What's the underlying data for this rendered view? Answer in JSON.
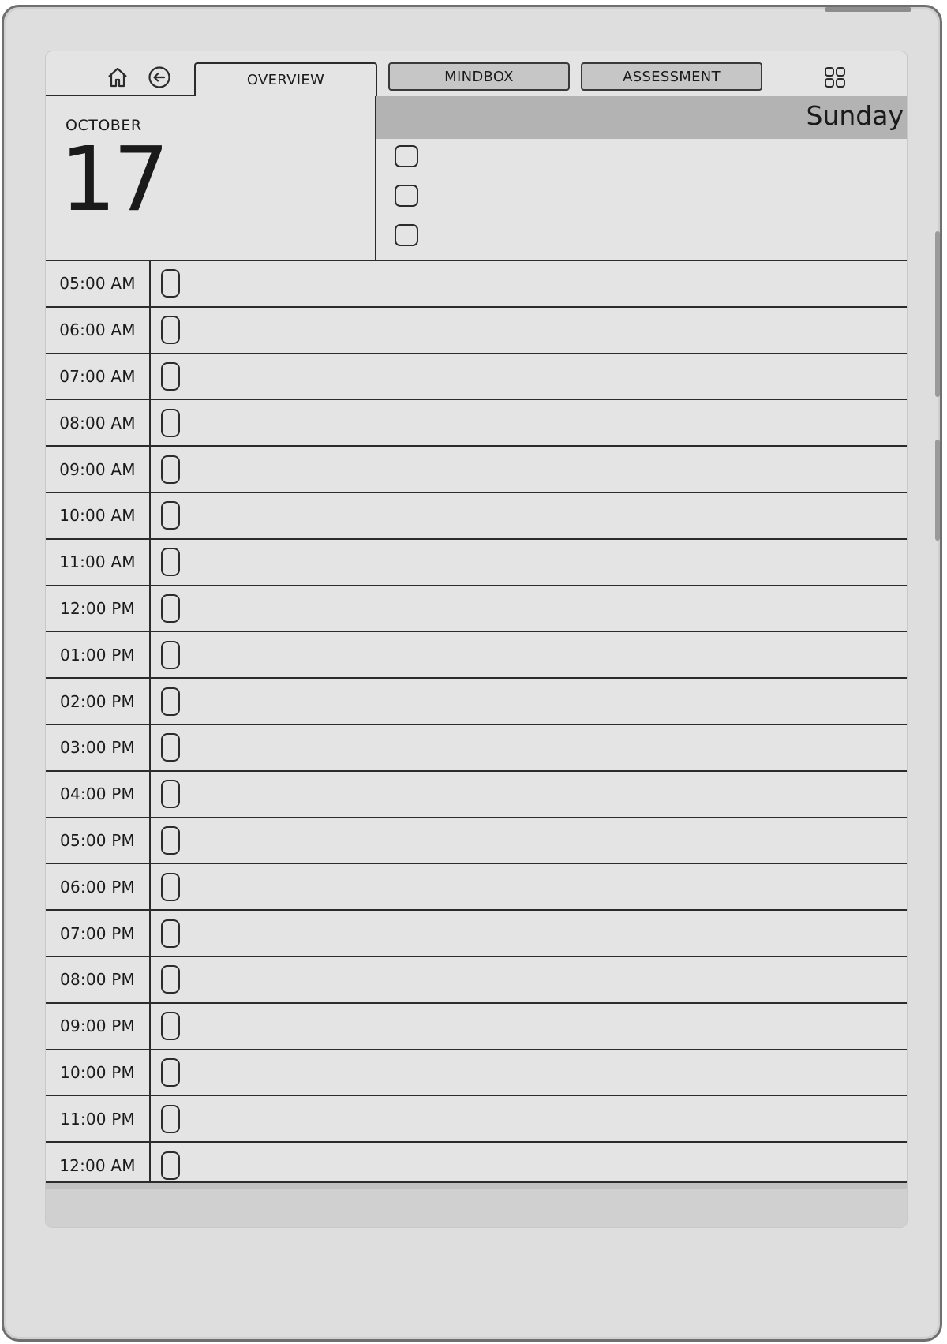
{
  "nav": {
    "home_icon": "home-icon",
    "back_icon": "back-arrow-icon",
    "grid_icon": "grid-icon"
  },
  "tabs": [
    {
      "label": "OVERVIEW",
      "active": true
    },
    {
      "label": "MINDBOX",
      "active": false
    },
    {
      "label": "ASSESSMENT",
      "active": false
    }
  ],
  "date": {
    "month": "OCTOBER",
    "day": "17",
    "weekday": "Sunday"
  },
  "todos": [
    {
      "checked": false
    },
    {
      "checked": false
    },
    {
      "checked": false
    }
  ],
  "schedule": [
    {
      "time": "05:00 AM",
      "checked": false,
      "entry": ""
    },
    {
      "time": "06:00 AM",
      "checked": false,
      "entry": ""
    },
    {
      "time": "07:00 AM",
      "checked": false,
      "entry": ""
    },
    {
      "time": "08:00 AM",
      "checked": false,
      "entry": ""
    },
    {
      "time": "09:00 AM",
      "checked": false,
      "entry": ""
    },
    {
      "time": "10:00 AM",
      "checked": false,
      "entry": ""
    },
    {
      "time": "11:00 AM",
      "checked": false,
      "entry": ""
    },
    {
      "time": "12:00 PM",
      "checked": false,
      "entry": ""
    },
    {
      "time": "01:00 PM",
      "checked": false,
      "entry": ""
    },
    {
      "time": "02:00 PM",
      "checked": false,
      "entry": ""
    },
    {
      "time": "03:00 PM",
      "checked": false,
      "entry": ""
    },
    {
      "time": "04:00 PM",
      "checked": false,
      "entry": ""
    },
    {
      "time": "05:00 PM",
      "checked": false,
      "entry": ""
    },
    {
      "time": "06:00 PM",
      "checked": false,
      "entry": ""
    },
    {
      "time": "07:00 PM",
      "checked": false,
      "entry": ""
    },
    {
      "time": "08:00 PM",
      "checked": false,
      "entry": ""
    },
    {
      "time": "09:00 PM",
      "checked": false,
      "entry": ""
    },
    {
      "time": "10:00 PM",
      "checked": false,
      "entry": ""
    },
    {
      "time": "11:00 PM",
      "checked": false,
      "entry": ""
    },
    {
      "time": "12:00 AM",
      "checked": false,
      "entry": ""
    }
  ],
  "colors": {
    "screen": "#e4e4e4",
    "day_bar": "#b3b3b3",
    "tab_inactive": "#c6c6c6",
    "ink": "#2b2b2b"
  }
}
